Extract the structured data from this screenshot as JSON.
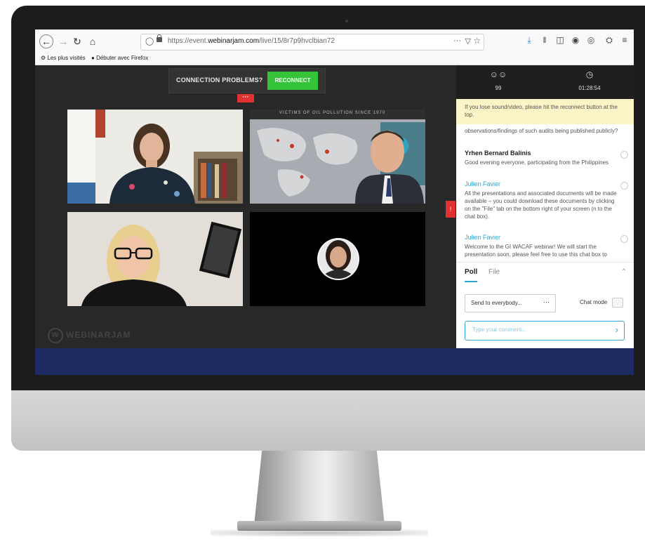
{
  "browser": {
    "url_prefix": "https://event.",
    "url_host": "webinarjam.com",
    "url_path": "/live/15/8r7p9hvclbian72",
    "url_menu": "···"
  },
  "bookmarks": [
    {
      "label": "Les plus visités"
    },
    {
      "label": "Débuter avec Firefox"
    }
  ],
  "stage": {
    "connection_label": "CONNECTION PROBLEMS?",
    "reconnect_label": "RECONNECT",
    "more_label": "···",
    "watermark": "WEBINARJAM",
    "map_banner": "VICTIMS OF OIL POLLUTION SINCE 1970",
    "side_tab": "!"
  },
  "chat": {
    "attendees_count": "99",
    "timer": "01:28:54",
    "notice": "If you lose sound/video, please hit the reconnect button at the top.",
    "partial_message": "observations/findings of such audits being published publicly?",
    "messages": [
      {
        "author": "Yrhen Bernard Balinis",
        "text": "Good evening everyone, participating from the Philippines"
      },
      {
        "author": "Julien Favier",
        "text": "All the presentations and associated documents will be made available – you could download these documents by clicking on the \"File\" tab on the bottom right of your screen (n to the chat box)."
      },
      {
        "author": "Julien Favier",
        "text": "Welcome to the GI WACAF webinar! We will start the presentation soon, please feel free to use this chat box to"
      }
    ],
    "tabs": [
      {
        "label": "Poll"
      },
      {
        "label": "File"
      }
    ],
    "send_to": "Send to everybody...",
    "send_dots": "···",
    "chat_mode_label": "Chat mode",
    "comment_placeholder": "Type your comment..."
  },
  "colors": {
    "reconnect_green": "#35c33a",
    "alert_red": "#e23131",
    "link_blue": "#2aa7d6",
    "notice_yellow": "#fbf4c6",
    "band_navy": "#1e2b63"
  }
}
